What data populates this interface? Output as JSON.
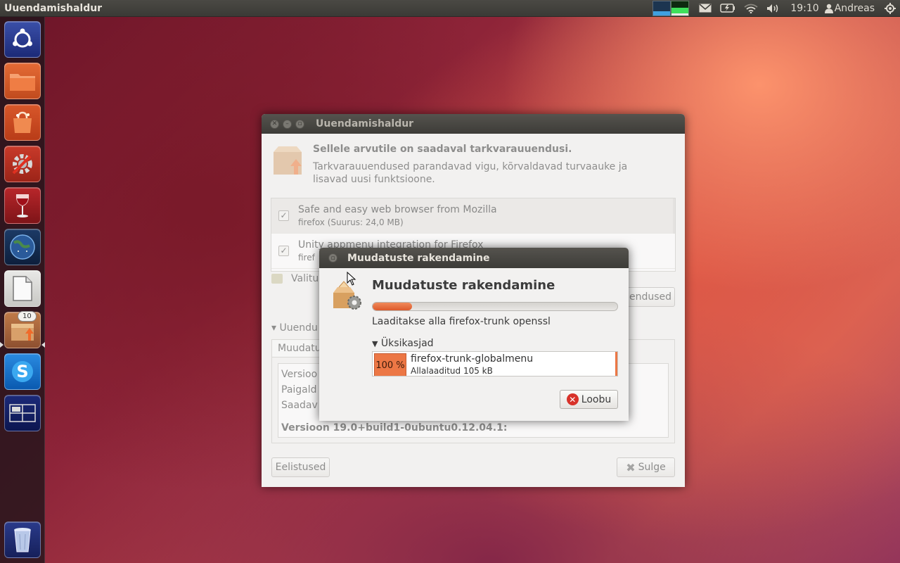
{
  "top_panel": {
    "app_title": "Uuendamishaldur",
    "clock": "19:10",
    "user": "Andreas"
  },
  "launcher": {
    "items": [
      {
        "name": "dash"
      },
      {
        "name": "files"
      },
      {
        "name": "software-center"
      },
      {
        "name": "system-settings"
      },
      {
        "name": "wine"
      },
      {
        "name": "web-browser"
      },
      {
        "name": "libreoffice"
      },
      {
        "name": "update-manager",
        "badge": "10"
      },
      {
        "name": "skype"
      },
      {
        "name": "workspace-switcher"
      },
      {
        "name": "trash"
      }
    ]
  },
  "main_window": {
    "title": "Uuendamishaldur",
    "heading": "Sellele arvutile on saadaval tarkvarauuendusi.",
    "description": "Tarkvarauuendused parandavad vigu, kõrvaldavad turvaauke ja lisavad uusi funktsioone.",
    "updates": [
      {
        "title": "Safe and easy web browser from Mozilla",
        "subtitle": "firefox (Suurus: 24,0 MB)",
        "checked": true
      },
      {
        "title": "Unity appmenu integration for Firefox",
        "subtitle": "firef",
        "checked": true
      }
    ],
    "selected_label": "Valitu",
    "install_button": "endused",
    "expander_label": "Uuendu",
    "tab_label": "Muudatu",
    "changelog_lines": [
      "Versioo",
      "Paigald",
      "Saadav"
    ],
    "changelog_version": "Versioon 19.0+build1-0ubuntu0.12.04.1:",
    "settings_button": "Eelistused",
    "close_button": "Sulge"
  },
  "dialog": {
    "title": "Muudatuste rakendamine",
    "heading": "Muudatuste rakendamine",
    "progress": 0.16,
    "status": "Laaditakse alla firefox-trunk openssl",
    "details_label": "Üksikasjad",
    "detail": {
      "percent": "100 %",
      "name": "firefox-trunk-globalmenu",
      "sub": "Allalaaditud 105 kB"
    },
    "cancel_button": "Loobu"
  },
  "colors": {
    "accent": "#dd5a2c",
    "panel": "#3b3a36",
    "window_bg": "#f2f1f0"
  }
}
